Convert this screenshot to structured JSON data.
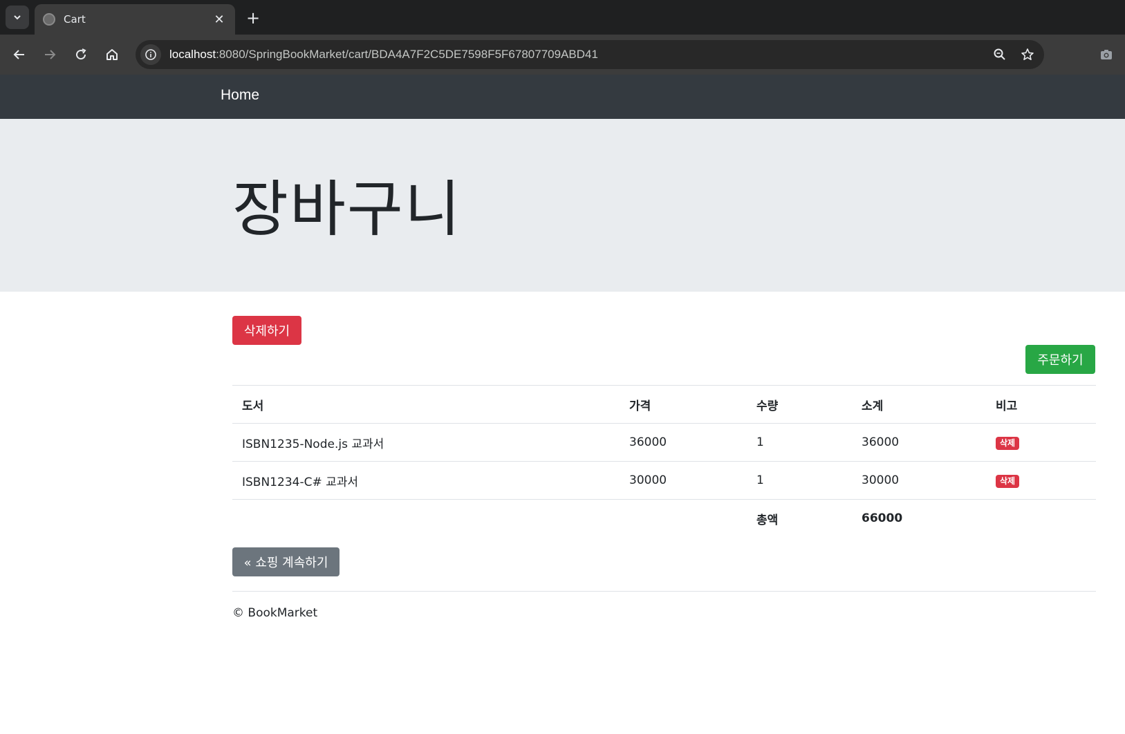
{
  "browser": {
    "tab_title": "Cart",
    "new_tab_label": "+",
    "close_tab_label": "✕",
    "url_host": "localhost",
    "url_path": ":8080/SpringBookMarket/cart/BDA4A7F2C5DE7598F5F67807709ABD41"
  },
  "navbar": {
    "brand": "Home"
  },
  "jumbotron": {
    "title": "장바구니"
  },
  "actions": {
    "clear_label": "삭제하기",
    "order_label": "주문하기",
    "continue_label": "« 쇼핑 계속하기"
  },
  "table": {
    "headers": [
      "도서",
      "가격",
      "수량",
      "소계",
      "비고"
    ],
    "rows": [
      {
        "book": "ISBN1235-Node.js 교과서",
        "price": "36000",
        "qty": "1",
        "subtotal": "36000",
        "action": "삭제"
      },
      {
        "book": "ISBN1234-C# 교과서",
        "price": "30000",
        "qty": "1",
        "subtotal": "30000",
        "action": "삭제"
      }
    ],
    "total_label": "총액",
    "total_value": "66000"
  },
  "footer": {
    "text": "© BookMarket"
  },
  "colors": {
    "danger": "#dc3545",
    "success": "#28a745",
    "secondary": "#6c757d",
    "navbar": "#343a40",
    "jumbotron": "#e9ecef"
  }
}
